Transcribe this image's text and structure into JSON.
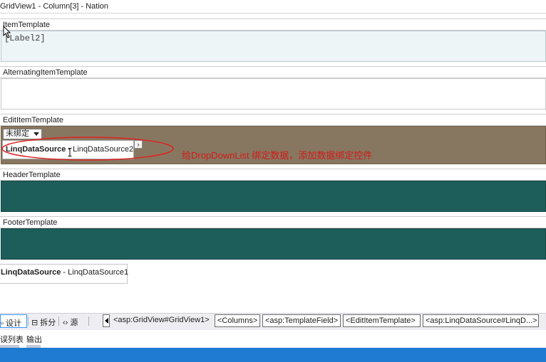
{
  "title": "GridView1 - Column[3] - Nation",
  "sections": {
    "item_template": {
      "label": "ItemTemplate",
      "content": "[Label2]"
    },
    "alternating_item_template": {
      "label": "AlternatingItemTemplate"
    },
    "edit_item_template": {
      "label": "EditItemTemplate",
      "dropdown_value": "未绑定",
      "datasource_bold": "LinqDataSource",
      "datasource_name": " - LinqDataSource2",
      "smart_tag": "›"
    },
    "header_template": {
      "label": "HeaderTemplate"
    },
    "footer_template": {
      "label": "FooterTemplate"
    }
  },
  "annotation": "给DropDownList 绑定数据，添加数据绑定控件",
  "page_datasource": {
    "bold": "LinqDataSource",
    "name": " - LinqDataSource1"
  },
  "view_modes": {
    "design": "▫ 设计",
    "split": "⊟ 拆分",
    "source": "‹› 源"
  },
  "breadcrumbs": [
    "<asp:GridView#GridView1>",
    "<Columns>",
    "<asp:TemplateField>",
    "<EditItemTemplate>",
    "<asp:LinqDataSource#LinqD...>"
  ],
  "tool_tabs": [
    "误列表",
    "输出"
  ],
  "colors": {
    "edit_region": "#887760",
    "teal_region": "#1e5e5a",
    "annotation": "#d11b1b",
    "status_bar": "#1f7ad1"
  }
}
